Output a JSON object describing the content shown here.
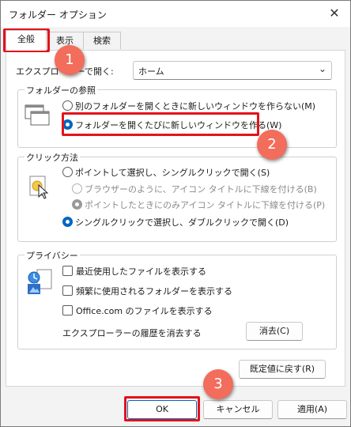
{
  "window": {
    "title": "フォルダー オプション"
  },
  "tabs": [
    "全般",
    "表示",
    "検索"
  ],
  "general": {
    "open_explorer_label": "エクスプローラーで開く:",
    "open_explorer_value": "ホーム"
  },
  "browse": {
    "title": "フォルダーの参照",
    "options": [
      "別のフォルダーを開くときに新しいウィンドウを作らない(M)",
      "フォルダーを開くたびに新しいウィンドウを作る(W)"
    ]
  },
  "click": {
    "title": "クリック方法",
    "options": [
      "ポイントして選択し、シングルクリックで開く(S)",
      "ブラウザーのように、アイコン タイトルに下線を付ける(B)",
      "ポイントしたときにのみアイコン タイトルに下線を付ける(P)",
      "シングルクリックで選択し、ダブルクリックで開く(D)"
    ]
  },
  "privacy": {
    "title": "プライバシー",
    "checks": [
      "最近使用したファイルを表示する",
      "頻繁に使用されるフォルダーを表示する",
      "Office.com のファイルを表示する"
    ],
    "clear_label": "エクスプローラーの履歴を消去する",
    "clear_button": "消去(C)"
  },
  "restore_button": "既定値に戻す(R)",
  "footer": {
    "ok": "OK",
    "cancel": "キャンセル",
    "apply": "適用(A)"
  },
  "annotations": [
    "1",
    "2",
    "3"
  ],
  "colors": {
    "accent": "#0067c0",
    "highlight": "#e3131a",
    "badge": "#f26d5b"
  }
}
